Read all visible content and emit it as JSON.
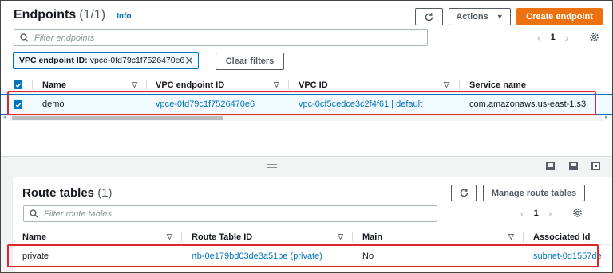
{
  "endpoints": {
    "title": "Endpoints",
    "count": "(1/1)",
    "info_label": "Info",
    "actions_label": "Actions",
    "create_label": "Create endpoint",
    "search_placeholder": "Filter endpoints",
    "page": "1",
    "filter_token_key": "VPC endpoint ID:",
    "filter_token_value": "vpce-0fd79c1f7526470e6",
    "clear_filters_label": "Clear filters",
    "columns": [
      "Name",
      "VPC endpoint ID",
      "VPC ID",
      "Service name"
    ],
    "rows": [
      {
        "name": "demo",
        "endpoint_id": "vpce-0fd79c1f7526470e6",
        "vpc_id": "vpc-0cf5cedce3c2f4f61 | default",
        "service_name": "com.amazonaws.us-east-1.s3",
        "selected": true
      }
    ]
  },
  "route_tables": {
    "title": "Route tables",
    "count": "(1)",
    "manage_label": "Manage route tables",
    "search_placeholder": "Filter route tables",
    "page": "1",
    "columns": [
      "Name",
      "Route Table ID",
      "Main",
      "Associated Id"
    ],
    "rows": [
      {
        "name": "private",
        "route_table_id": "rtb-0e179bd03de3a51be (private)",
        "main": "No",
        "associated_id": "subnet-0d1557de"
      }
    ]
  },
  "colors": {
    "accent_link": "#0073bb",
    "primary_button": "#ec7211",
    "highlight_box": "#e3242b"
  },
  "icons": [
    "refresh-icon",
    "caret-down-icon",
    "search-icon",
    "settings-gear-icon",
    "close-icon",
    "check-icon",
    "sort-icon",
    "chevron-left-icon",
    "chevron-right-icon",
    "layout-icon"
  ]
}
